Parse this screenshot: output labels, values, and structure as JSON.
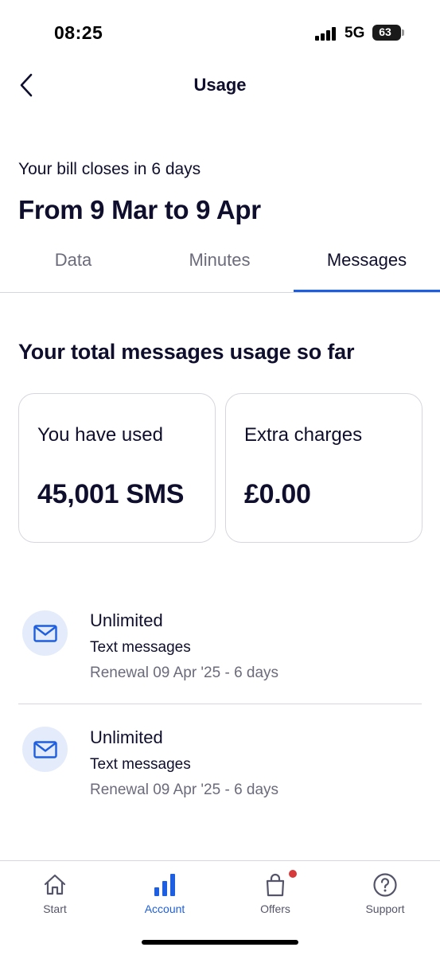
{
  "status_bar": {
    "time": "08:25",
    "network": "5G",
    "battery": "63",
    "battery_level": 0.63,
    "icons": [
      "signal-bars-icon",
      "battery-icon"
    ]
  },
  "header": {
    "title": "Usage",
    "back_icon": "chevron-left-icon"
  },
  "bill": {
    "closes_text": "Your bill closes in 6 days",
    "period": "From 9 Mar to 9 Apr"
  },
  "tabs": [
    {
      "label": "Data",
      "active": false
    },
    {
      "label": "Minutes",
      "active": false
    },
    {
      "label": "Messages",
      "active": true
    }
  ],
  "colors": {
    "accent": "#1d5fe0",
    "text_primary": "#0f0f2d",
    "text_secondary": "#6b6b7b",
    "icon_bg": "#e4ecfb",
    "notification_dot": "#d63a3a"
  },
  "usage": {
    "section_title": "Your total messages usage so far",
    "used_label": "You have used",
    "used_value": "45,001 SMS",
    "charges_label": "Extra charges",
    "charges_value": "£0.00"
  },
  "allowances": [
    {
      "icon": "envelope-icon",
      "title": "Unlimited",
      "type": "Text messages",
      "renewal": "Renewal 09 Apr '25 - 6 days"
    },
    {
      "icon": "envelope-icon",
      "title": "Unlimited",
      "type": "Text messages",
      "renewal": "Renewal 09 Apr '25 - 6 days"
    }
  ],
  "bottom_nav": [
    {
      "label": "Start",
      "icon": "home-icon",
      "active": false
    },
    {
      "label": "Account",
      "icon": "bar-chart-icon",
      "active": true
    },
    {
      "label": "Offers",
      "icon": "shopping-bag-icon",
      "active": false,
      "badge": true
    },
    {
      "label": "Support",
      "icon": "question-circle-icon",
      "active": false
    }
  ]
}
